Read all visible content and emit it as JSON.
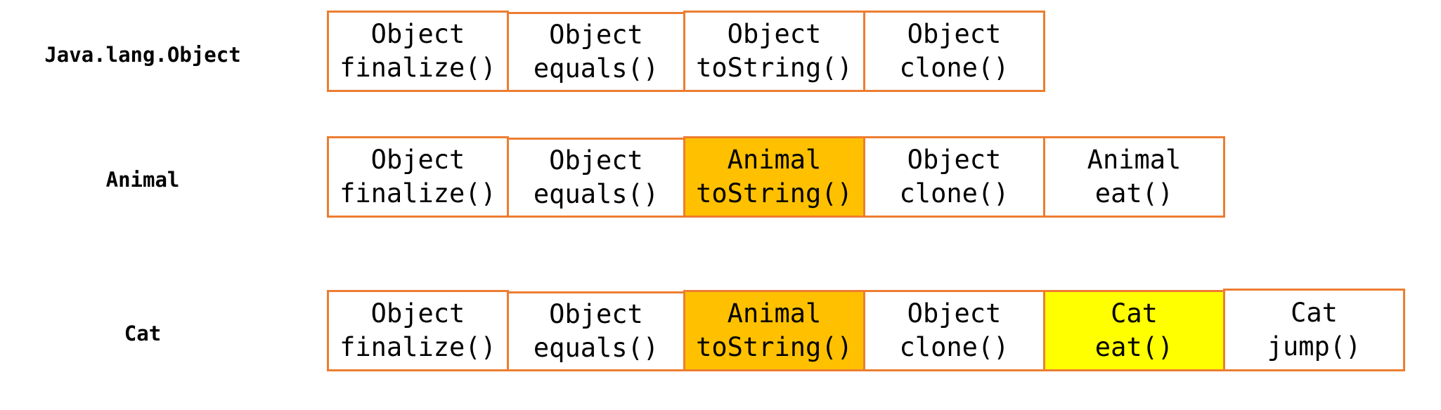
{
  "colors": {
    "border": "#ED7D31",
    "plain": "#FFFFFF",
    "animal_override": "#FFC000",
    "cat_override": "#FFFF00"
  },
  "rows": [
    {
      "label": "Java.lang.Object",
      "cells": [
        {
          "owner": "Object",
          "method": "finalize()"
        },
        {
          "owner": "Object",
          "method": "equals()"
        },
        {
          "owner": "Object",
          "method": "toString()"
        },
        {
          "owner": "Object",
          "method": "clone()"
        }
      ]
    },
    {
      "label": "Animal",
      "cells": [
        {
          "owner": "Object",
          "method": "finalize()"
        },
        {
          "owner": "Object",
          "method": "equals()"
        },
        {
          "owner": "Animal",
          "method": "toString()",
          "fill": "animal_override"
        },
        {
          "owner": "Object",
          "method": "clone()"
        },
        {
          "owner": "Animal",
          "method": "eat()"
        }
      ]
    },
    {
      "label": "Cat",
      "cells": [
        {
          "owner": "Object",
          "method": "finalize()"
        },
        {
          "owner": "Object",
          "method": "equals()"
        },
        {
          "owner": "Animal",
          "method": "toString()",
          "fill": "animal_override"
        },
        {
          "owner": "Object",
          "method": "clone()"
        },
        {
          "owner": "Cat",
          "method": "eat()",
          "fill": "cat_override"
        },
        {
          "owner": "Cat",
          "method": "jump()"
        }
      ]
    }
  ]
}
